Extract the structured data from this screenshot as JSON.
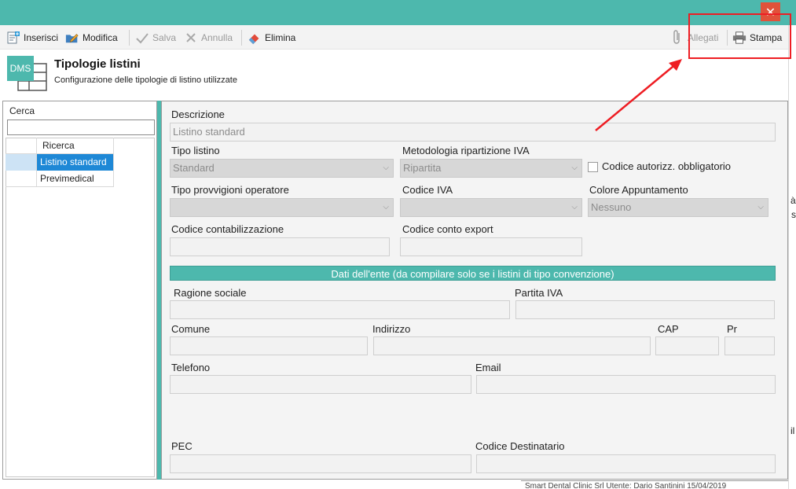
{
  "toolbar": {
    "inserisci": "Inserisci",
    "modifica": "Modifica",
    "salva": "Salva",
    "annulla": "Annulla",
    "elimina": "Elimina",
    "allegati": "Allegati",
    "stampa": "Stampa"
  },
  "header": {
    "logo_text": "DMS",
    "title": "Tipologie listini",
    "subtitle": "Configurazione delle tipologie di listino utilizzate"
  },
  "left_panel": {
    "search_label": "Cerca",
    "search_value": "",
    "grid_header": "Ricerca",
    "items": [
      "Listino standard",
      "Previmedical"
    ],
    "selected_index": 0
  },
  "form": {
    "descrizione_label": "Descrizione",
    "descrizione_value": "Listino standard",
    "tipo_listino_label": "Tipo listino",
    "tipo_listino_value": "Standard",
    "metodologia_label": "Metodologia ripartizione IVA",
    "metodologia_value": "Ripartita",
    "codice_autorizz_label": "Codice autorizz. obbligatorio",
    "codice_autorizz_checked": false,
    "tipo_provvigioni_label": "Tipo provvigioni operatore",
    "tipo_provvigioni_value": "",
    "codice_iva_label": "Codice IVA",
    "codice_iva_value": "",
    "colore_label": "Colore Appuntamento",
    "colore_value": "Nessuno",
    "codice_contab_label": "Codice contabilizzazione",
    "codice_contab_value": "",
    "codice_export_label": "Codice conto export",
    "codice_export_value": "",
    "section_title": "Dati dell'ente (da compilare solo se i listini di tipo convenzione)",
    "ragione_sociale_label": "Ragione sociale",
    "partita_iva_label": "Partita IVA",
    "comune_label": "Comune",
    "indirizzo_label": "Indirizzo",
    "cap_label": "CAP",
    "pr_label": "Pr",
    "telefono_label": "Telefono",
    "email_label": "Email",
    "pec_label": "PEC",
    "codice_dest_label": "Codice Destinatario"
  },
  "status_bar": {
    "text": "Smart Dental Clinic Srl Utente: Dario Santinini 15/04/2019"
  },
  "edge_text": {
    "a": "à",
    "s": "s",
    "il": "il"
  },
  "colors": {
    "accent": "#4db8ad",
    "close": "#e0523a",
    "selection": "#1e88d6",
    "annotation": "#ee1d23"
  }
}
